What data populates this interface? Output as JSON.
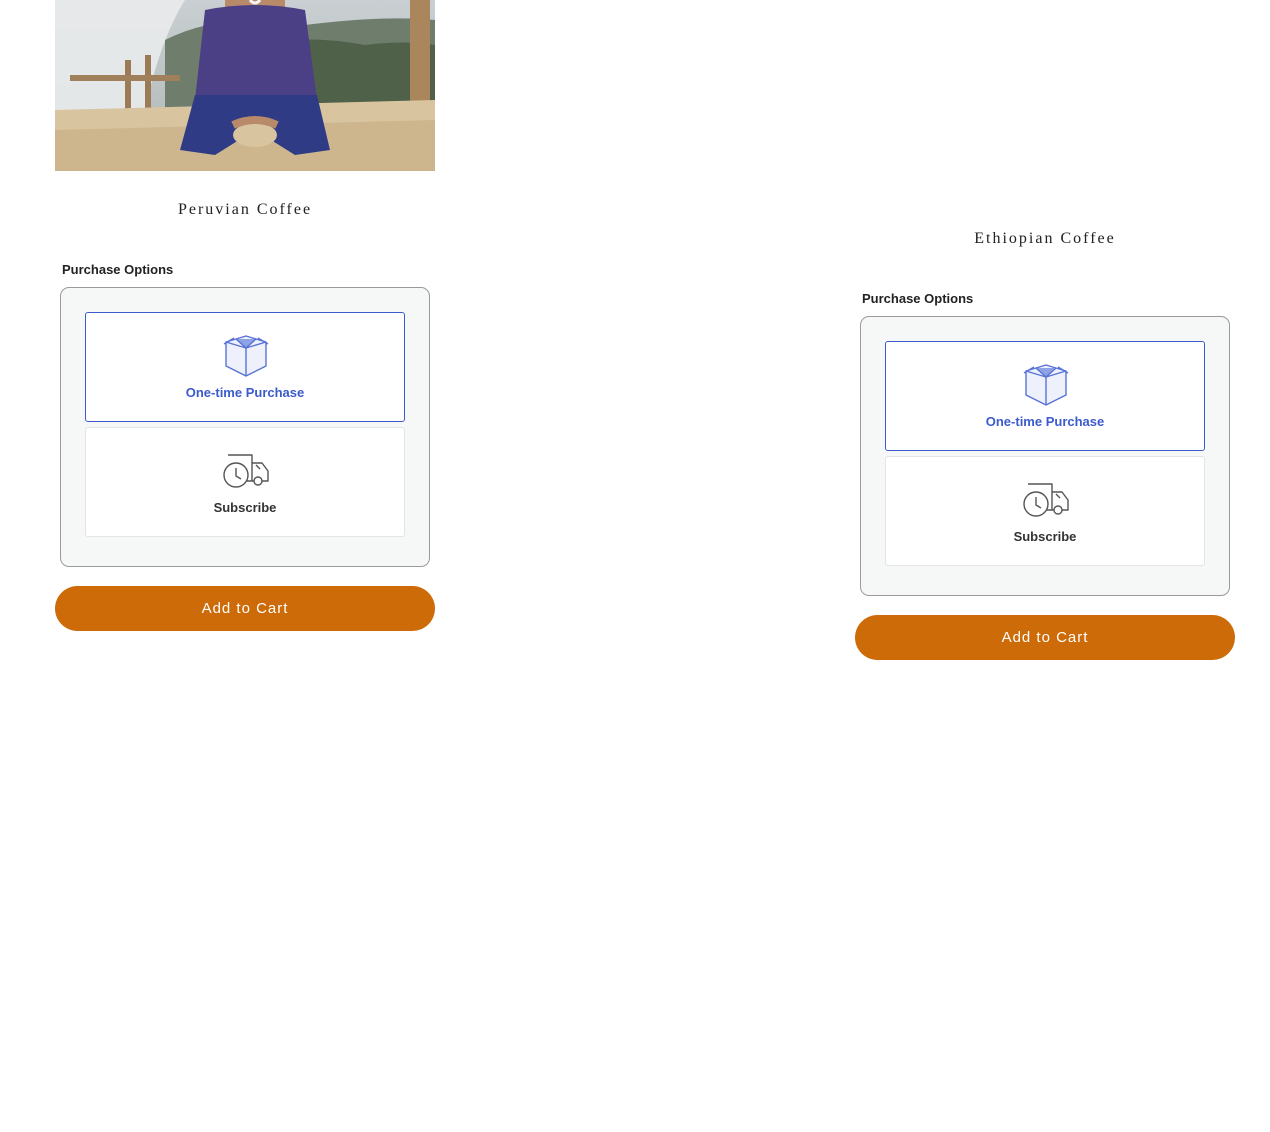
{
  "products": [
    {
      "title": "Peruvian Coffee",
      "purchase_options_label": "Purchase Options",
      "options": [
        {
          "label": "One-time Purchase",
          "icon": "open-box-icon",
          "selected": true
        },
        {
          "label": "Subscribe",
          "icon": "delivery-truck-clock-icon",
          "selected": false
        }
      ],
      "add_to_cart_label": "Add to Cart"
    },
    {
      "title": "Ethiopian Coffee",
      "purchase_options_label": "Purchase Options",
      "options": [
        {
          "label": "One-time Purchase",
          "icon": "open-box-icon",
          "selected": true
        },
        {
          "label": "Subscribe",
          "icon": "delivery-truck-clock-icon",
          "selected": false
        }
      ],
      "add_to_cart_label": "Add to Cart"
    }
  ],
  "colors": {
    "accent": "#3b5bcd",
    "button": "#cd6b08",
    "panel": "#f6f7f7"
  }
}
